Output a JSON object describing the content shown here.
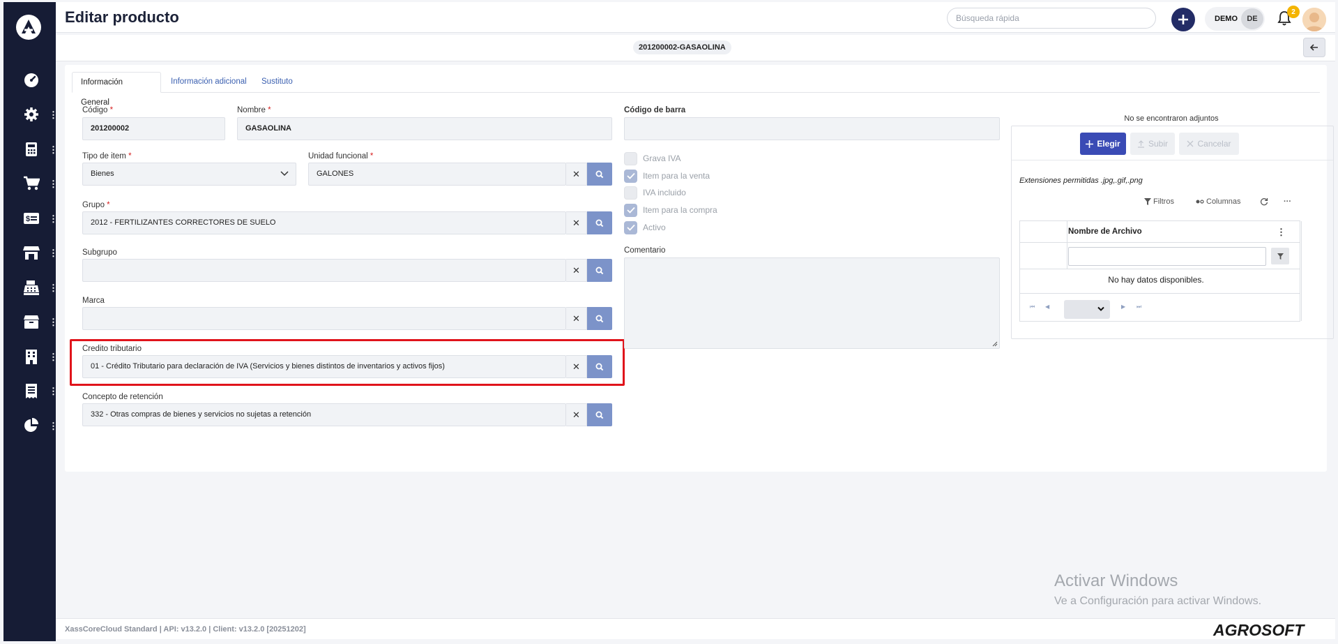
{
  "header": {
    "title": "Editar producto",
    "search_placeholder": "Búsqueda rápida",
    "user_name": "DEMO",
    "user_initials": "DE",
    "notification_count": "2"
  },
  "subheader": {
    "record": "201200002-GASAOLINA"
  },
  "tabs": [
    {
      "label": "Información General",
      "active": true
    },
    {
      "label": "Información adicional",
      "active": false
    },
    {
      "label": "Sustituto",
      "active": false
    }
  ],
  "form": {
    "codigo": {
      "label": "Código",
      "value": "201200002"
    },
    "nombre": {
      "label": "Nombre",
      "value": "GASAOLINA"
    },
    "codigo_barra": {
      "label": "Código de barra",
      "value": ""
    },
    "tipo_item": {
      "label": "Tipo de item",
      "value": "Bienes"
    },
    "unidad_funcional": {
      "label": "Unidad funcional",
      "value": "GALONES"
    },
    "grupo": {
      "label": "Grupo",
      "value": "2012 - FERTILIZANTES CORRECTORES DE SUELO"
    },
    "subgrupo": {
      "label": "Subgrupo",
      "value": ""
    },
    "marca": {
      "label": "Marca",
      "value": ""
    },
    "credito_tributario": {
      "label": "Credito tributario",
      "value": "01 - Crédito Tributario para declaración de IVA (Servicios y bienes distintos de inventarios y activos fijos)"
    },
    "concepto_retencion": {
      "label": "Concepto de retención",
      "value": "332 - Otras compras de bienes y servicios no sujetas a retención"
    },
    "comentario": {
      "label": "Comentario",
      "value": ""
    }
  },
  "checkboxes": [
    {
      "label": "Grava IVA",
      "checked": false
    },
    {
      "label": "Item para la venta",
      "checked": true
    },
    {
      "label": "IVA incluido",
      "checked": false
    },
    {
      "label": "Item para la compra",
      "checked": true
    },
    {
      "label": "Activo",
      "checked": true
    }
  ],
  "attachments": {
    "title": "No se encontraron adjuntos",
    "choose_label": "Elegir",
    "upload_label": "Subir",
    "cancel_label": "Cancelar",
    "extensions": "Extensiones permitidas .jpg,.gif,.png",
    "filters_label": "Filtros",
    "columns_label": "Columnas",
    "column_header": "Nombre de Archivo",
    "empty_text": "No hay datos disponibles."
  },
  "footer": {
    "version": "XassCoreCloud Standard | API: v13.2.0 | Client: v13.2.0 [20251202]",
    "brand": "AGROSOFT"
  },
  "watermark": {
    "title": "Activar Windows",
    "subtitle": "Ve a Configuración para activar Windows."
  },
  "colors": {
    "sidebar": "#161c35",
    "accent": "#3a4bb5",
    "search_button": "#7c93c9",
    "highlight": "#e0141b"
  }
}
